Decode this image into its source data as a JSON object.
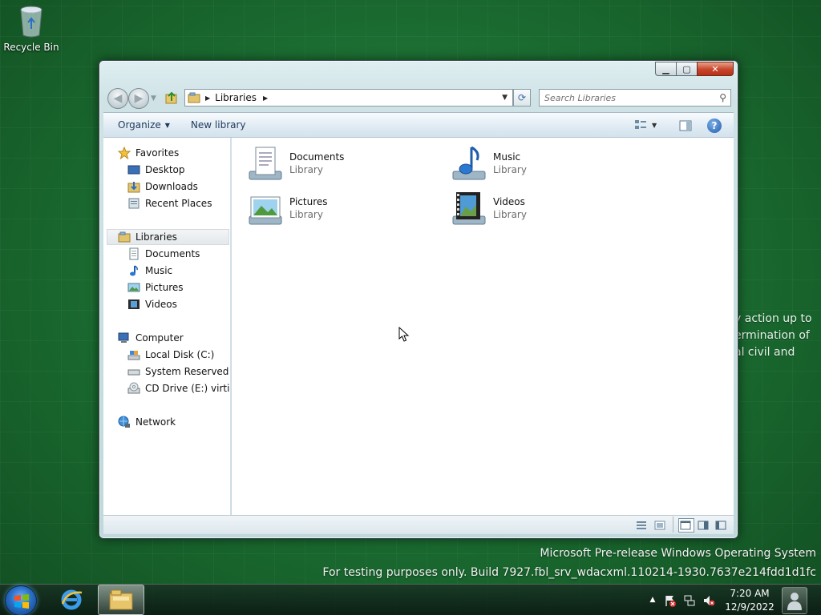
{
  "desktop": {
    "recycle_bin_label": "Recycle Bin",
    "background_text_lines": [
      "y action up to",
      "ermination of",
      "al civil and"
    ],
    "watermark_line1": "Microsoft Pre-release Windows Operating System",
    "watermark_line2": "For testing purposes only. Build 7927.fbl_srv_wdacxml.110214-1930.7637e214fdd1d1fc"
  },
  "window": {
    "address": {
      "segments": [
        "Libraries"
      ]
    },
    "search": {
      "placeholder": "Search Libraries"
    },
    "toolbar": {
      "organize_label": "Organize",
      "new_library_label": "New library"
    },
    "nav_pane": {
      "favorites": {
        "label": "Favorites",
        "items": [
          {
            "label": "Desktop",
            "icon": "desktop-icon"
          },
          {
            "label": "Downloads",
            "icon": "downloads-icon"
          },
          {
            "label": "Recent Places",
            "icon": "recent-places-icon"
          }
        ]
      },
      "libraries": {
        "label": "Libraries",
        "selected": true,
        "items": [
          {
            "label": "Documents",
            "icon": "documents-icon"
          },
          {
            "label": "Music",
            "icon": "music-icon"
          },
          {
            "label": "Pictures",
            "icon": "pictures-icon"
          },
          {
            "label": "Videos",
            "icon": "videos-icon"
          }
        ]
      },
      "computer": {
        "label": "Computer",
        "items": [
          {
            "label": "Local Disk (C:)",
            "icon": "local-disk-icon"
          },
          {
            "label": "System Reserved (D:",
            "icon": "drive-icon"
          },
          {
            "label": "CD Drive (E:) virtio-v",
            "icon": "cd-drive-icon"
          }
        ]
      },
      "network": {
        "label": "Network"
      }
    },
    "content": {
      "libraries": [
        {
          "name": "Documents",
          "type": "Library",
          "icon": "documents-library-icon"
        },
        {
          "name": "Music",
          "type": "Library",
          "icon": "music-library-icon"
        },
        {
          "name": "Pictures",
          "type": "Library",
          "icon": "pictures-library-icon"
        },
        {
          "name": "Videos",
          "type": "Library",
          "icon": "videos-library-icon"
        }
      ]
    }
  },
  "taskbar": {
    "clock_time": "7:20 AM",
    "clock_date": "12/9/2022"
  },
  "colors": {
    "desktop_green": "#1b6b2e",
    "close_red": "#c7442a",
    "link_blue": "#1e395b"
  }
}
